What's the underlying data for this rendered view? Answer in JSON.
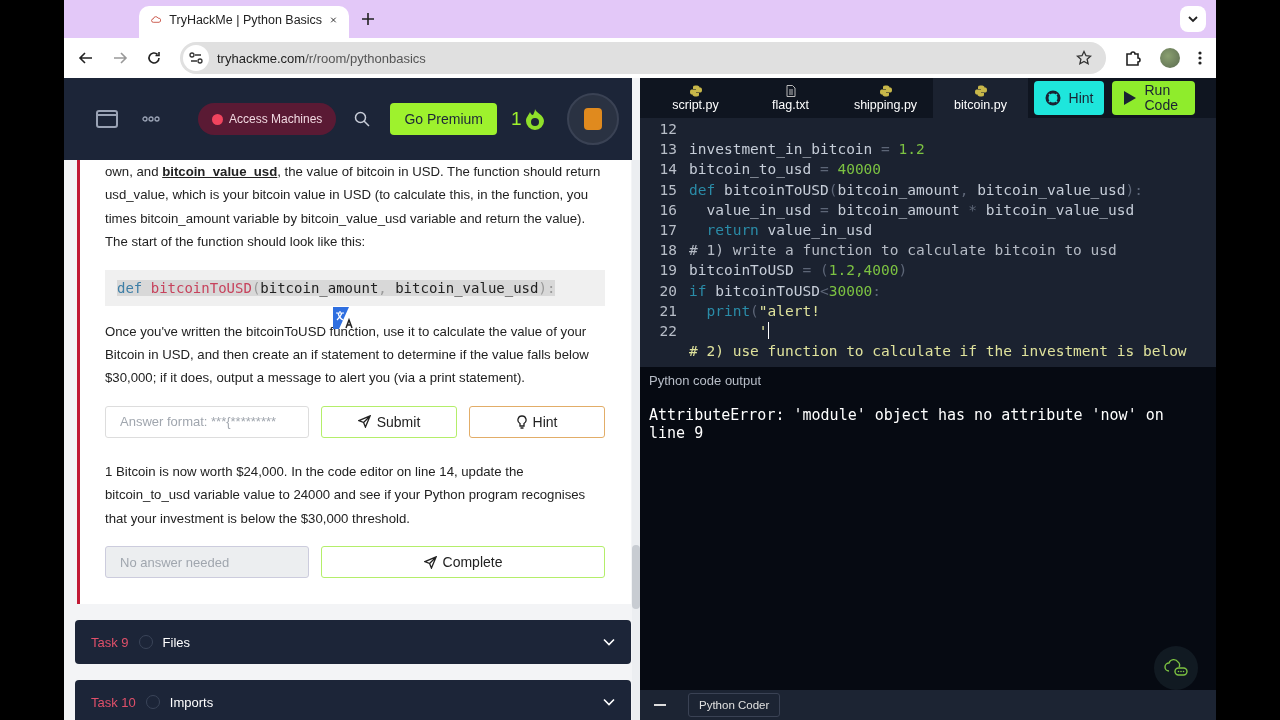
{
  "browser": {
    "tab_title": "TryHackMe | Python Basics",
    "url_host": "tryhackme.com",
    "url_path": "/r/room/pythonbasics"
  },
  "navbar": {
    "access_button": "Access Machines",
    "premium_button": "Go Premium",
    "streak": "1"
  },
  "task_text": {
    "paragraphs_top": [
      "own, and **bitcoin_value_usd**, the value of bitcoin in USD. The function should return usd_value, which is your bitcoin value in USD (to calculate this, in the function, you times bitcoin_amount variable by bitcoin_value_usd variable and return the value). The start of the function should look like this:"
    ],
    "code_sample": [
      {
        "kind": "keyword",
        "text": "def"
      },
      {
        "kind": "function",
        "text": " bitcoinToUSD"
      },
      {
        "kind": "punct",
        "text": "("
      },
      {
        "kind": "plain",
        "text": "bitcoin_amount"
      },
      {
        "kind": "punct",
        "text": ", "
      },
      {
        "kind": "plain",
        "text": "bitcoin_value_usd"
      },
      {
        "kind": "punct",
        "text": "):"
      }
    ],
    "paragraph_after": "Once you've written the bitcoinToUSD function, use it to calculate the value of your Bitcoin in USD, and then create an if statement to determine if the value falls below $30,000; if it does, output a message to alert you (via a print statement).",
    "questions": [
      {
        "field": {
          "placeholder": "Answer format: ***{*********",
          "disabled": false
        },
        "buttons": [
          {
            "kind": "submit",
            "label": "Submit"
          },
          {
            "kind": "hint",
            "label": "Hint"
          }
        ]
      },
      {
        "text": "1 Bitcoin is now worth $24,000. In the code editor on line 14, update the bitcoin_to_usd variable value to 24000 and see if your Python program recognises that your investment is below the $30,000 threshold.",
        "field": {
          "placeholder": "No answer needed",
          "disabled": true
        },
        "buttons": [
          {
            "kind": "submit",
            "label": "Complete"
          }
        ]
      }
    ]
  },
  "tasks": [
    {
      "number": "Task 9",
      "title": "Files",
      "completed": false
    },
    {
      "number": "Task 10",
      "title": "Imports",
      "completed": false
    }
  ],
  "editor": {
    "files": [
      {
        "name": "script.py",
        "kind": "python",
        "selected": false
      },
      {
        "name": "flag.txt",
        "kind": "text",
        "selected": false
      },
      {
        "name": "shipping.py",
        "kind": "python",
        "selected": false
      },
      {
        "name": "bitcoin.py",
        "kind": "python",
        "selected": true
      }
    ],
    "hint_button": "Hint",
    "run_button": "Run Code",
    "lines": [
      {
        "number": "12"
      },
      {
        "number": "13",
        "tokens": [
          {
            "kind": "plain",
            "text": "investment_in_bitcoin"
          },
          {
            "kind": "punct",
            "text": " = "
          },
          {
            "kind": "number",
            "text": "1.2"
          }
        ]
      },
      {
        "number": "14",
        "tokens": [
          {
            "kind": "plain",
            "text": "bitcoin_to_usd"
          },
          {
            "kind": "punct",
            "text": " = "
          },
          {
            "kind": "number",
            "text": "40000"
          }
        ]
      },
      {
        "number": "15",
        "tokens": [
          {
            "kind": "keyword",
            "text": "def"
          },
          {
            "kind": "plain",
            "text": " bitcoinToUSD"
          },
          {
            "kind": "punct",
            "text": "("
          },
          {
            "kind": "plain",
            "text": "bitcoin_amount"
          },
          {
            "kind": "punct",
            "text": ", "
          },
          {
            "kind": "plain",
            "text": "bitcoin_value_usd"
          },
          {
            "kind": "punct",
            "text": "):"
          }
        ]
      },
      {
        "number": "16",
        "tokens": [
          {
            "kind": "plain",
            "text": "  value_in_usd"
          },
          {
            "kind": "punct",
            "text": " = "
          },
          {
            "kind": "plain",
            "text": "bitcoin_amount"
          },
          {
            "kind": "punct",
            "text": " * "
          },
          {
            "kind": "plain",
            "text": "bitcoin_value_usd"
          }
        ]
      },
      {
        "number": "17",
        "tokens": [
          {
            "kind": "keyword",
            "text": "  return"
          },
          {
            "kind": "plain",
            "text": " value_in_usd"
          }
        ]
      },
      {
        "number": "18",
        "tokens": [
          {
            "kind": "comment",
            "text": "# 1) write a function to calculate bitcoin to usd"
          }
        ]
      },
      {
        "number": "19",
        "tokens": [
          {
            "kind": "plain",
            "text": "bitcoinToUSD"
          },
          {
            "kind": "punct",
            "text": " = ("
          },
          {
            "kind": "number",
            "text": "1.2,4000"
          },
          {
            "kind": "punct",
            "text": ")"
          }
        ]
      },
      {
        "number": "20",
        "tokens": [
          {
            "kind": "keyword",
            "text": "if"
          },
          {
            "kind": "plain",
            "text": " bitcoinToUSD"
          },
          {
            "kind": "punct",
            "text": "<"
          },
          {
            "kind": "number",
            "text": "30000"
          },
          {
            "kind": "punct",
            "text": ":"
          }
        ]
      },
      {
        "number": "21",
        "tokens": [
          {
            "kind": "keyword",
            "text": "  print"
          },
          {
            "kind": "punct",
            "text": "("
          },
          {
            "kind": "string",
            "text": "\"alert!"
          }
        ]
      },
      {
        "number": "22",
        "tokens": [
          {
            "kind": "string",
            "text": "        '"
          }
        ],
        "cursor": true
      },
      {
        "tokens": [
          {
            "kind": "string",
            "text": "# 2) use function to calculate if the investment is below"
          }
        ]
      }
    ],
    "output_title": "Python code output",
    "output_text": "AttributeError: 'module' object has no attribute 'now' on line 9",
    "panel_tab": "Python Coder"
  }
}
